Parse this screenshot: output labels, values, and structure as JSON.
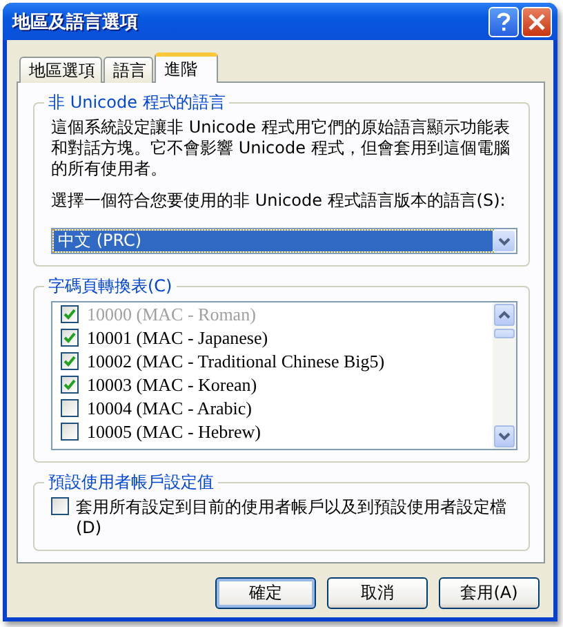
{
  "window": {
    "title": "地區及語言選項"
  },
  "tabs": [
    {
      "label": "地區選項",
      "selected": false
    },
    {
      "label": "語言",
      "selected": false
    },
    {
      "label": "進階",
      "selected": true
    }
  ],
  "non_unicode": {
    "legend": "非 Unicode 程式的語言",
    "description": "這個系統設定讓非 Unicode 程式用它們的原始語言顯示功能表和對話方塊。它不會影響 Unicode 程式，但會套用到這個電腦的所有使用者。",
    "prompt": "選擇一個符合您要使用的非 Unicode 程式語言版本的語言(S):",
    "selection": "中文 (PRC)"
  },
  "code_pages": {
    "legend": "字碼頁轉換表(C)",
    "items": [
      {
        "label": "10000 (MAC - Roman)",
        "checked": true,
        "disabled": true
      },
      {
        "label": "10001 (MAC - Japanese)",
        "checked": true,
        "disabled": false
      },
      {
        "label": "10002 (MAC - Traditional Chinese Big5)",
        "checked": true,
        "disabled": false
      },
      {
        "label": "10003 (MAC - Korean)",
        "checked": true,
        "disabled": false
      },
      {
        "label": "10004 (MAC - Arabic)",
        "checked": false,
        "disabled": false
      },
      {
        "label": "10005 (MAC - Hebrew)",
        "checked": false,
        "disabled": false
      }
    ]
  },
  "default_user": {
    "legend": "預設使用者帳戶設定值",
    "option": {
      "label": "套用所有設定到目前的使用者帳戶以及到預設使用者設定檔(D)",
      "checked": false
    }
  },
  "buttons": [
    {
      "label": "確定",
      "default": true
    },
    {
      "label": "取消",
      "default": false
    },
    {
      "label": "套用(A)",
      "default": false
    }
  ]
}
